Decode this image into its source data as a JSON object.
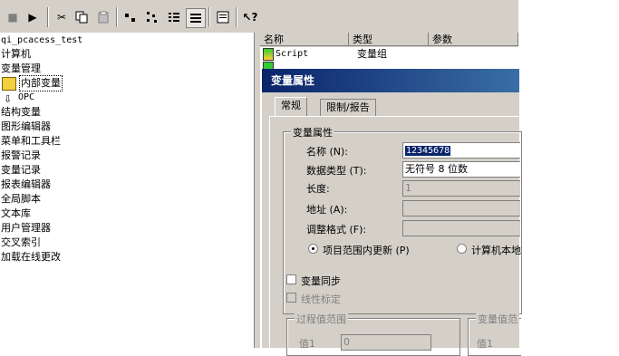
{
  "toolbar": {
    "buttons": [
      {
        "name": "stop-icon",
        "glyph": "■"
      },
      {
        "name": "run-icon",
        "glyph": "▶"
      },
      {
        "name": "cut-icon",
        "glyph": "✂"
      },
      {
        "name": "copy-icon",
        "glyph": "⧉"
      },
      {
        "name": "paste-icon",
        "glyph": "📋"
      },
      {
        "name": "small-icons-view-icon",
        "glyph": "⠿"
      },
      {
        "name": "list-view-icon",
        "glyph": "☰"
      },
      {
        "name": "details-view-icon",
        "glyph": "▦"
      },
      {
        "name": "properties-icon",
        "glyph": "🗎"
      },
      {
        "name": "help-icon",
        "glyph": "?"
      }
    ]
  },
  "tree": {
    "project": "qi_pcacess_test",
    "items": [
      "计算机",
      "变量管理",
      "内部变量",
      "OPC",
      "结构变量",
      "图形编辑器",
      "菜单和工具栏",
      "报警记录",
      "变量记录",
      "报表编辑器",
      "全局脚本",
      "文本库",
      "用户管理器",
      "交叉索引",
      "加载在线更改"
    ]
  },
  "list": {
    "columns": [
      "名称",
      "类型",
      "参数"
    ],
    "rows": [
      {
        "name": "Script",
        "type": "变量组"
      }
    ]
  },
  "dialog": {
    "title": "变量属性",
    "tabs": [
      "常规",
      "限制/报告"
    ],
    "group_title": "变量属性",
    "name_label": "名称 (N):",
    "name_value": "12345678",
    "datatype_label": "数据类型 (T):",
    "datatype_value": "无符号 8 位数",
    "length_label": "长度:",
    "length_value": "1",
    "address_label": "地址 (A):",
    "format_label": "调整格式 (F):",
    "radio_project": "项目范围内更新 (P)",
    "radio_computer": "计算机本地",
    "sync_label": "变量同步",
    "linear_label": "线性标定",
    "process_range": "过程值范围",
    "var_range": "变量值范",
    "value1_label": "值1",
    "value1_value": "0",
    "value1b_label": "值1"
  }
}
